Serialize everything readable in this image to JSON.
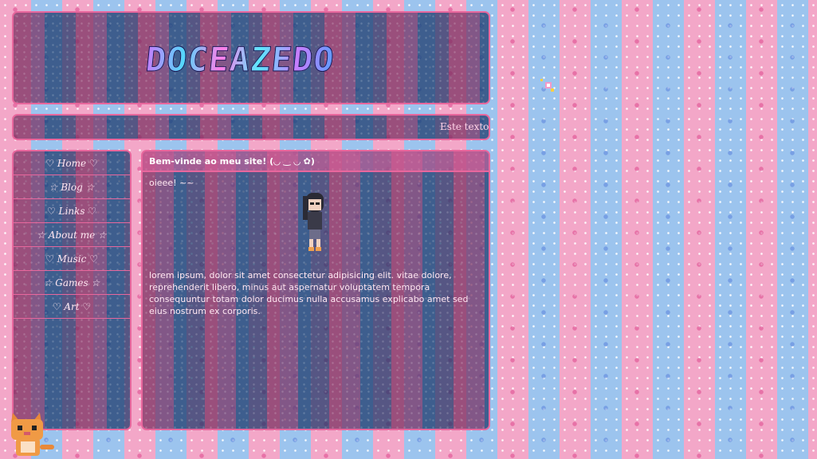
{
  "header": {
    "logo_text": "DOCEAZEDO"
  },
  "marquee": {
    "text": "Este texto v"
  },
  "sidebar": {
    "items": [
      {
        "label": "♡ Home ♡"
      },
      {
        "label": "☆ Blog ☆"
      },
      {
        "label": "♡ Links ♡"
      },
      {
        "label": "☆ About me ☆"
      },
      {
        "label": "♡ Music ♡"
      },
      {
        "label": "☆ Games ☆"
      },
      {
        "label": "♡ Art ♡"
      }
    ]
  },
  "main": {
    "title": "Bem-vinde ao meu site! (◡ ‿ ◡ ✿)",
    "greeting": "oieee! ~~",
    "body": "lorem ipsum, dolor sit amet consectetur adipisicing elit. vitae dolore, reprehenderit libero, minus aut aspernatur voluptatem tempora consequuntur totam dolor ducimus nulla accusamus explicabo amet sed eius nostrum ex corporis."
  },
  "colors": {
    "pink": "#f3a7c8",
    "blue": "#9cc4ee",
    "border": "#e8679d"
  }
}
